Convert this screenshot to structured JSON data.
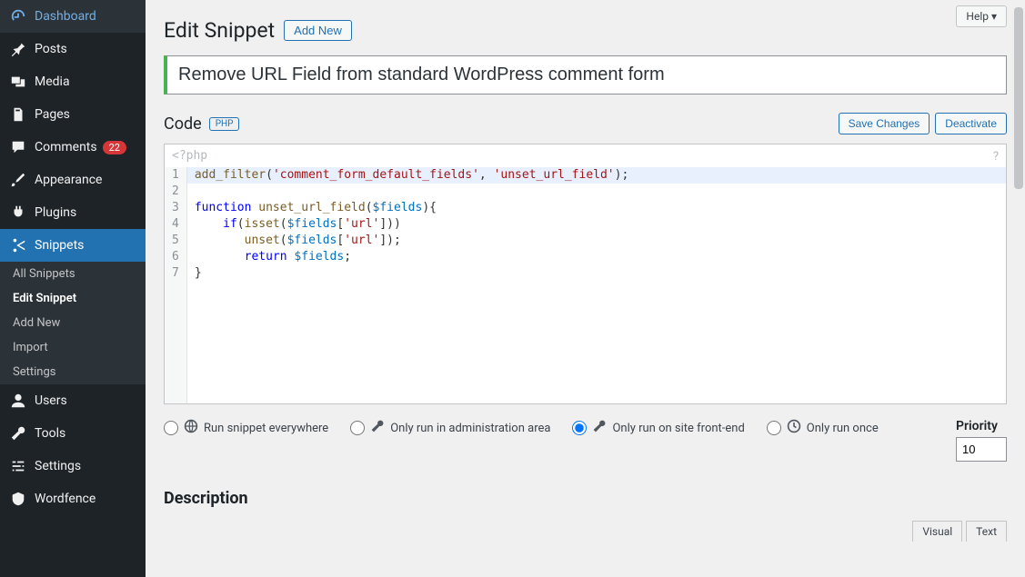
{
  "sidebar": {
    "items": [
      {
        "label": "Dashboard",
        "icon": "speedometer"
      },
      {
        "label": "Posts",
        "icon": "pin"
      },
      {
        "label": "Media",
        "icon": "media"
      },
      {
        "label": "Pages",
        "icon": "pages"
      },
      {
        "label": "Comments",
        "icon": "comment",
        "badge": "22"
      },
      {
        "label": "Appearance",
        "icon": "brush"
      },
      {
        "label": "Plugins",
        "icon": "plug"
      },
      {
        "label": "Snippets",
        "icon": "scissors",
        "active": true
      },
      {
        "label": "Users",
        "icon": "user"
      },
      {
        "label": "Tools",
        "icon": "wrench"
      },
      {
        "label": "Settings",
        "icon": "sliders"
      },
      {
        "label": "Wordfence",
        "icon": "shield"
      }
    ],
    "submenu": [
      {
        "label": "All Snippets"
      },
      {
        "label": "Edit Snippet",
        "current": true
      },
      {
        "label": "Add New"
      },
      {
        "label": "Import"
      },
      {
        "label": "Settings"
      }
    ]
  },
  "header": {
    "title": "Edit Snippet",
    "add_new": "Add New",
    "help": "Help ▾"
  },
  "snippet": {
    "title_value": "Remove URL Field from standard WordPress comment form"
  },
  "code": {
    "section_label": "Code",
    "lang_tag": "PHP",
    "save_btn": "Save Changes",
    "deactivate_btn": "Deactivate",
    "hint": "<?php",
    "lines": [
      {
        "n": 1,
        "tokens": [
          {
            "t": "add_filter",
            "c": "fn"
          },
          {
            "t": "("
          },
          {
            "t": "'comment_form_default_fields'",
            "c": "str"
          },
          {
            "t": ", "
          },
          {
            "t": "'unset_url_field'",
            "c": "str"
          },
          {
            "t": ");"
          }
        ],
        "hl": true
      },
      {
        "n": 2,
        "tokens": [
          {
            "t": "function",
            "c": "kw"
          },
          {
            "t": " "
          },
          {
            "t": "unset_url_field",
            "c": "fn"
          },
          {
            "t": "("
          },
          {
            "t": "$fields",
            "c": "var"
          },
          {
            "t": "){"
          }
        ]
      },
      {
        "n": 3,
        "tokens": [
          {
            "t": "    "
          },
          {
            "t": "if",
            "c": "kw"
          },
          {
            "t": "("
          },
          {
            "t": "isset",
            "c": "fn"
          },
          {
            "t": "("
          },
          {
            "t": "$fields",
            "c": "var"
          },
          {
            "t": "["
          },
          {
            "t": "'url'",
            "c": "str"
          },
          {
            "t": "]))"
          }
        ]
      },
      {
        "n": 4,
        "tokens": [
          {
            "t": "       "
          },
          {
            "t": "unset",
            "c": "fn"
          },
          {
            "t": "("
          },
          {
            "t": "$fields",
            "c": "var"
          },
          {
            "t": "["
          },
          {
            "t": "'url'",
            "c": "str"
          },
          {
            "t": "]);"
          }
        ]
      },
      {
        "n": 5,
        "tokens": [
          {
            "t": "       "
          },
          {
            "t": "return",
            "c": "kw"
          },
          {
            "t": " "
          },
          {
            "t": "$fields",
            "c": "var"
          },
          {
            "t": ";"
          }
        ]
      },
      {
        "n": 6,
        "tokens": [
          {
            "t": "}"
          }
        ]
      },
      {
        "n": 7,
        "tokens": []
      }
    ]
  },
  "run": {
    "options": [
      {
        "label": "Run snippet everywhere",
        "icon": "globe",
        "checked": false
      },
      {
        "label": "Only run in administration area",
        "icon": "wrench",
        "checked": false
      },
      {
        "label": "Only run on site front-end",
        "icon": "wrench",
        "checked": true
      },
      {
        "label": "Only run once",
        "icon": "clock",
        "checked": false
      }
    ],
    "priority_label": "Priority",
    "priority_value": "10"
  },
  "description": {
    "label": "Description",
    "tabs": [
      "Visual",
      "Text"
    ]
  }
}
